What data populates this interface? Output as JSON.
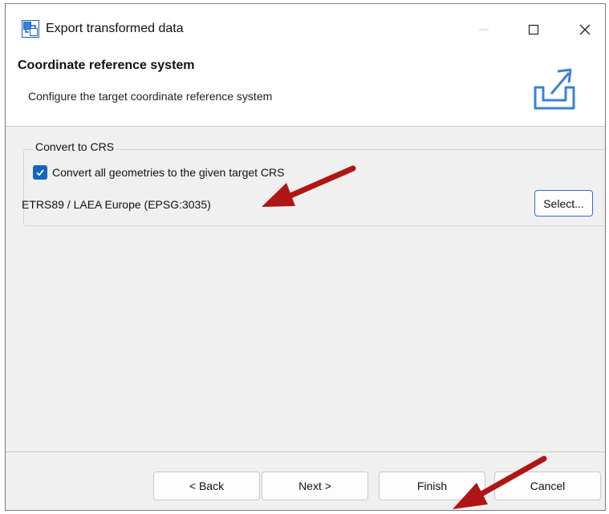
{
  "window": {
    "title": "Export transformed data",
    "controls": {
      "minimize": "—",
      "maximize": "☐",
      "close": "✕"
    }
  },
  "header": {
    "title": "Coordinate reference system",
    "description": "Configure the target coordinate reference system",
    "icon": "export-icon"
  },
  "crs_group": {
    "legend": "Convert to CRS",
    "checkbox_label": "Convert all geometries to the given target CRS",
    "checkbox_checked": true,
    "crs_value": "ETRS89 / LAEA Europe (EPSG:3035)",
    "select_button": "Select..."
  },
  "footer": {
    "back": "< Back",
    "next": "Next >",
    "finish": "Finish",
    "cancel": "Cancel"
  },
  "annotations": {
    "arrow_color": "#b01515"
  },
  "colors": {
    "accent": "#1565c0",
    "dialog_bg": "#f0f0f0",
    "header_bg": "#ffffff"
  }
}
